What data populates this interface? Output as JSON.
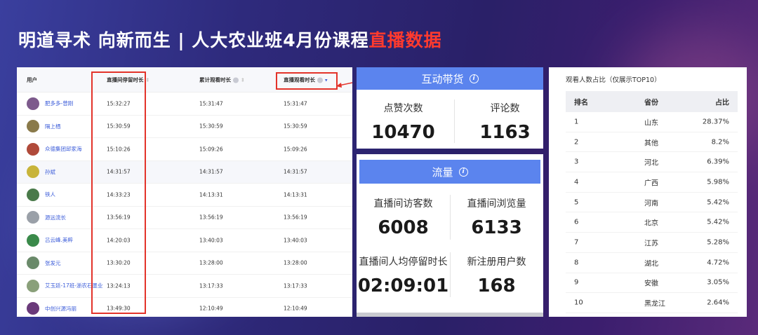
{
  "header": {
    "title_main": "明道寻术  向新而生 | 人大农业班4月份课程",
    "title_highlight": "直播数据"
  },
  "viewer_table": {
    "columns": [
      "用户",
      "直播间停留时长",
      "累计观看时长",
      "直播观看时长"
    ],
    "rows": [
      {
        "user": "肥多多-曾刚",
        "stay": "15:32:27",
        "total": "15:31:47",
        "live": "15:31:47",
        "avatar_color": "#7d5a8c"
      },
      {
        "user": "隔上栖",
        "stay": "15:30:59",
        "total": "15:30:59",
        "live": "15:30:59",
        "avatar_color": "#8a7a4a"
      },
      {
        "user": "众德集团邱家海",
        "stay": "15:10:26",
        "total": "15:09:26",
        "live": "15:09:26",
        "avatar_color": "#b04a3a"
      },
      {
        "user": "孙斌",
        "stay": "14:31:57",
        "total": "14:31:57",
        "live": "14:31:57",
        "avatar_color": "#c8b43a"
      },
      {
        "user": "铁人",
        "stay": "14:33:23",
        "total": "14:13:31",
        "live": "14:13:31",
        "avatar_color": "#4a7a4a"
      },
      {
        "user": "源远流长",
        "stay": "13:56:19",
        "total": "13:56:19",
        "live": "13:56:19",
        "avatar_color": "#9aa0a8"
      },
      {
        "user": "吕云峰.美粹",
        "stay": "14:20:03",
        "total": "13:40:03",
        "live": "13:40:03",
        "avatar_color": "#3a8a4a"
      },
      {
        "user": "张发元",
        "stay": "13:30:20",
        "total": "13:28:00",
        "live": "13:28:00",
        "avatar_color": "#6a8a6a"
      },
      {
        "user": "艾玉廷-17班-浙农石墨业",
        "stay": "13:24:13",
        "total": "13:17:33",
        "live": "13:17:33",
        "avatar_color": "#8aa07a"
      },
      {
        "user": "中创兴源冯丽",
        "stay": "13:49:30",
        "total": "12:10:49",
        "live": "12:10:49",
        "avatar_color": "#6a3a7a"
      }
    ]
  },
  "interaction_card": {
    "title": "互动带货",
    "stats": [
      {
        "label": "点赞次数",
        "value": "10470"
      },
      {
        "label": "评论数",
        "value": "1163"
      }
    ]
  },
  "traffic_card": {
    "title": "流量",
    "stats": [
      {
        "label": "直播间访客数",
        "value": "6008"
      },
      {
        "label": "直播间浏览量",
        "value": "6133"
      },
      {
        "label": "直播间人均停留时长",
        "value": "02:09:01"
      },
      {
        "label": "新注册用户数",
        "value": "168"
      }
    ]
  },
  "province_table": {
    "title": "观看人数占比（仅展示TOP10）",
    "columns": [
      "排名",
      "省份",
      "占比"
    ],
    "rows": [
      {
        "rank": "1",
        "province": "山东",
        "share": "28.37%"
      },
      {
        "rank": "2",
        "province": "其他",
        "share": "8.2%"
      },
      {
        "rank": "3",
        "province": "河北",
        "share": "6.39%"
      },
      {
        "rank": "4",
        "province": "广西",
        "share": "5.98%"
      },
      {
        "rank": "5",
        "province": "河南",
        "share": "5.42%"
      },
      {
        "rank": "6",
        "province": "北京",
        "share": "5.42%"
      },
      {
        "rank": "7",
        "province": "江苏",
        "share": "5.28%"
      },
      {
        "rank": "8",
        "province": "湖北",
        "share": "4.72%"
      },
      {
        "rank": "9",
        "province": "安徽",
        "share": "3.05%"
      },
      {
        "rank": "10",
        "province": "黑龙江",
        "share": "2.64%"
      }
    ]
  },
  "colors": {
    "accent_blue": "#5b84ee",
    "highlight_red": "#ff3a2e",
    "annotation_red": "#e3332a",
    "link_blue": "#3a5bd9"
  },
  "icons": {
    "info": "info-icon",
    "sort": "sort-icon"
  }
}
